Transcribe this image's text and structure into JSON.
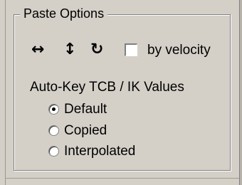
{
  "paste_options": {
    "title": "Paste Options",
    "icons": [
      {
        "name": "horizontal-arrows-icon",
        "glyph": "↔"
      },
      {
        "name": "vertical-arrows-icon",
        "glyph": "↕"
      },
      {
        "name": "rotate-icon",
        "glyph": "↻"
      }
    ],
    "by_velocity": {
      "label": "by velocity",
      "checked": false
    },
    "auto_key_label": "Auto-Key TCB / IK Values",
    "options": [
      {
        "label": "Default",
        "selected": true
      },
      {
        "label": "Copied",
        "selected": false
      },
      {
        "label": "Interpolated",
        "selected": false
      }
    ]
  }
}
